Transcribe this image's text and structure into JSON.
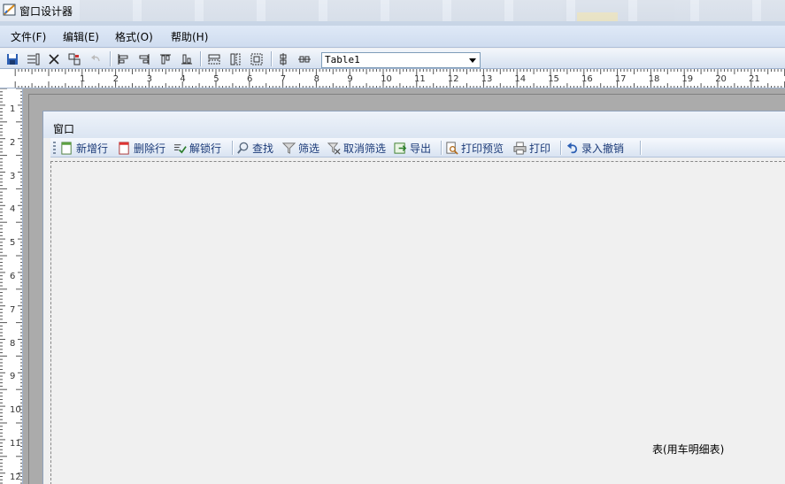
{
  "window": {
    "title": "窗口设计器"
  },
  "menu": [
    {
      "label": "文件(F)"
    },
    {
      "label": "编辑(E)"
    },
    {
      "label": "格式(O)"
    },
    {
      "label": "帮助(H)"
    }
  ],
  "toolbar": {
    "icons": [
      "save-icon",
      "properties-icon",
      "delete-icon",
      "copy-format-icon",
      "undo-icon",
      "align-left-icon",
      "align-right-icon",
      "align-top-icon",
      "align-bottom-icon",
      "same-width-icon",
      "same-height-icon",
      "same-size-icon",
      "center-vertical-icon",
      "center-horizontal-icon"
    ],
    "object_select": "Table1"
  },
  "ruler": {
    "horizontal": [
      "1",
      "2",
      "3",
      "4",
      "5",
      "6",
      "7",
      "8",
      "9",
      "10",
      "11",
      "12",
      "13",
      "14",
      "15",
      "16",
      "17",
      "18",
      "19",
      "20",
      "21"
    ],
    "vertical": [
      "1",
      "2",
      "3",
      "4",
      "5",
      "6",
      "7",
      "8",
      "9",
      "10",
      "11",
      "12"
    ]
  },
  "form": {
    "title": "窗口",
    "toolbar_items": [
      {
        "label": "新增行",
        "icon": "new-row-icon"
      },
      {
        "label": "删除行",
        "icon": "delete-row-icon"
      },
      {
        "label": "解锁行",
        "icon": "unlock-row-icon"
      },
      {
        "label": "查找",
        "icon": "search-icon"
      },
      {
        "label": "筛选",
        "icon": "filter-icon"
      },
      {
        "label": "取消筛选",
        "icon": "clear-filter-icon"
      },
      {
        "label": "导出",
        "icon": "export-icon"
      },
      {
        "label": "打印预览",
        "icon": "print-preview-icon"
      },
      {
        "label": "打印",
        "icon": "print-icon"
      },
      {
        "label": "录入撤销",
        "icon": "undo-entry-icon"
      }
    ],
    "table_caption": "表(用车明细表)"
  }
}
